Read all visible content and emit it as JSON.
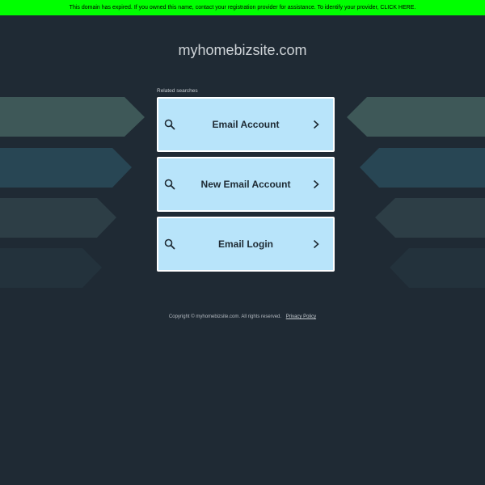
{
  "banner": {
    "text": "This domain has expired. If you owned this name, contact your registration provider for assistance. To identify your provider, CLICK HERE."
  },
  "header": {
    "domain": "myhomebizsite.com"
  },
  "related": {
    "label": "Related searches",
    "items": [
      {
        "label": "Email Account",
        "icon": "search-icon",
        "trailing_icon": "chevron-right-icon"
      },
      {
        "label": "New Email Account",
        "icon": "search-icon",
        "trailing_icon": "chevron-right-icon"
      },
      {
        "label": "Email Login",
        "icon": "search-icon",
        "trailing_icon": "chevron-right-icon"
      }
    ]
  },
  "footer": {
    "copyright": "Copyright © myhomebizsite.com.  All rights reserved.",
    "privacy_label": "Privacy Policy"
  },
  "colors": {
    "background": "#1f2a34",
    "banner": "#00ff00",
    "card": "#b8e4fa",
    "decor": [
      "#3e5858",
      "#284654",
      "#2d3e46",
      "#23323c"
    ]
  }
}
